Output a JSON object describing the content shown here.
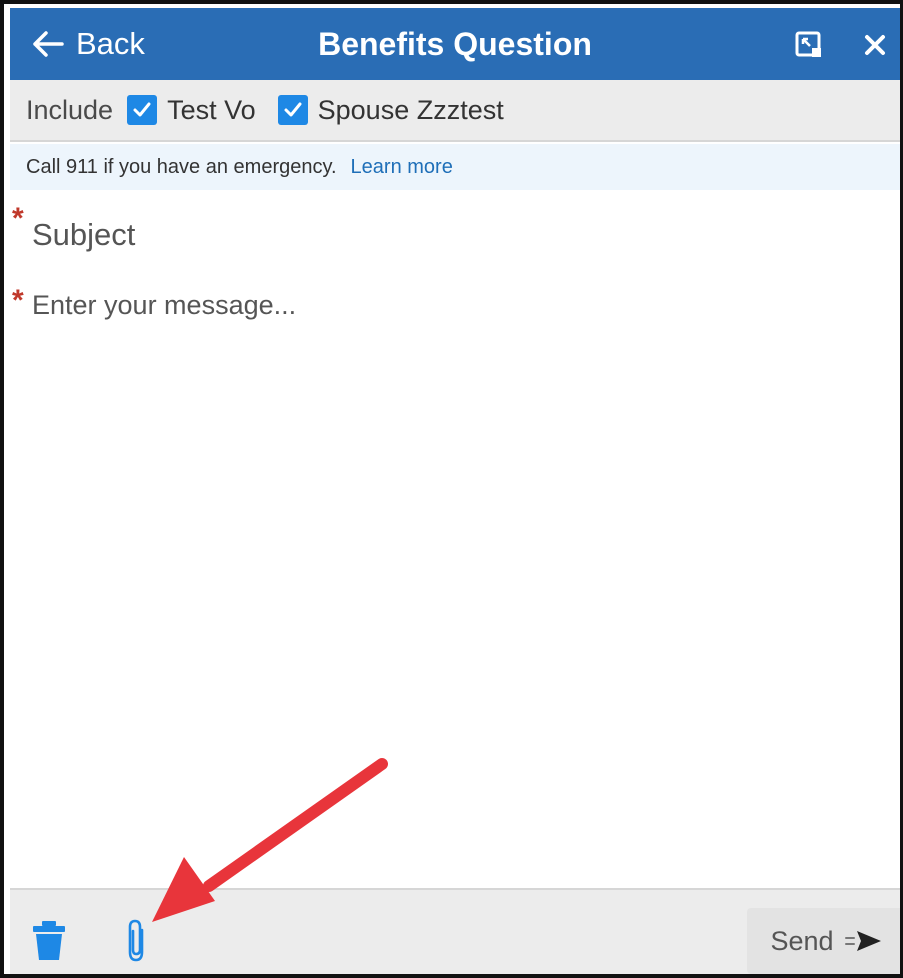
{
  "header": {
    "back_label": "Back",
    "title": "Benefits Question",
    "accent_color": "#2a6db5"
  },
  "include_bar": {
    "label": "Include",
    "recipients": [
      {
        "label": "Test Vo",
        "checked": true
      },
      {
        "label": "Spouse Zzztest",
        "checked": true
      }
    ],
    "checkbox_color": "#1e88e5"
  },
  "notice": {
    "text": "Call 911 if you have an emergency.",
    "link": "Learn more"
  },
  "form": {
    "required_marker": "*",
    "subject_placeholder": "Subject",
    "message_placeholder": "Enter your message..."
  },
  "footer": {
    "send_label": "Send",
    "icons": [
      "trash-icon",
      "paperclip-icon",
      "send-arrow-icon"
    ]
  },
  "annotation": {
    "arrow_color": "#e8353b"
  }
}
